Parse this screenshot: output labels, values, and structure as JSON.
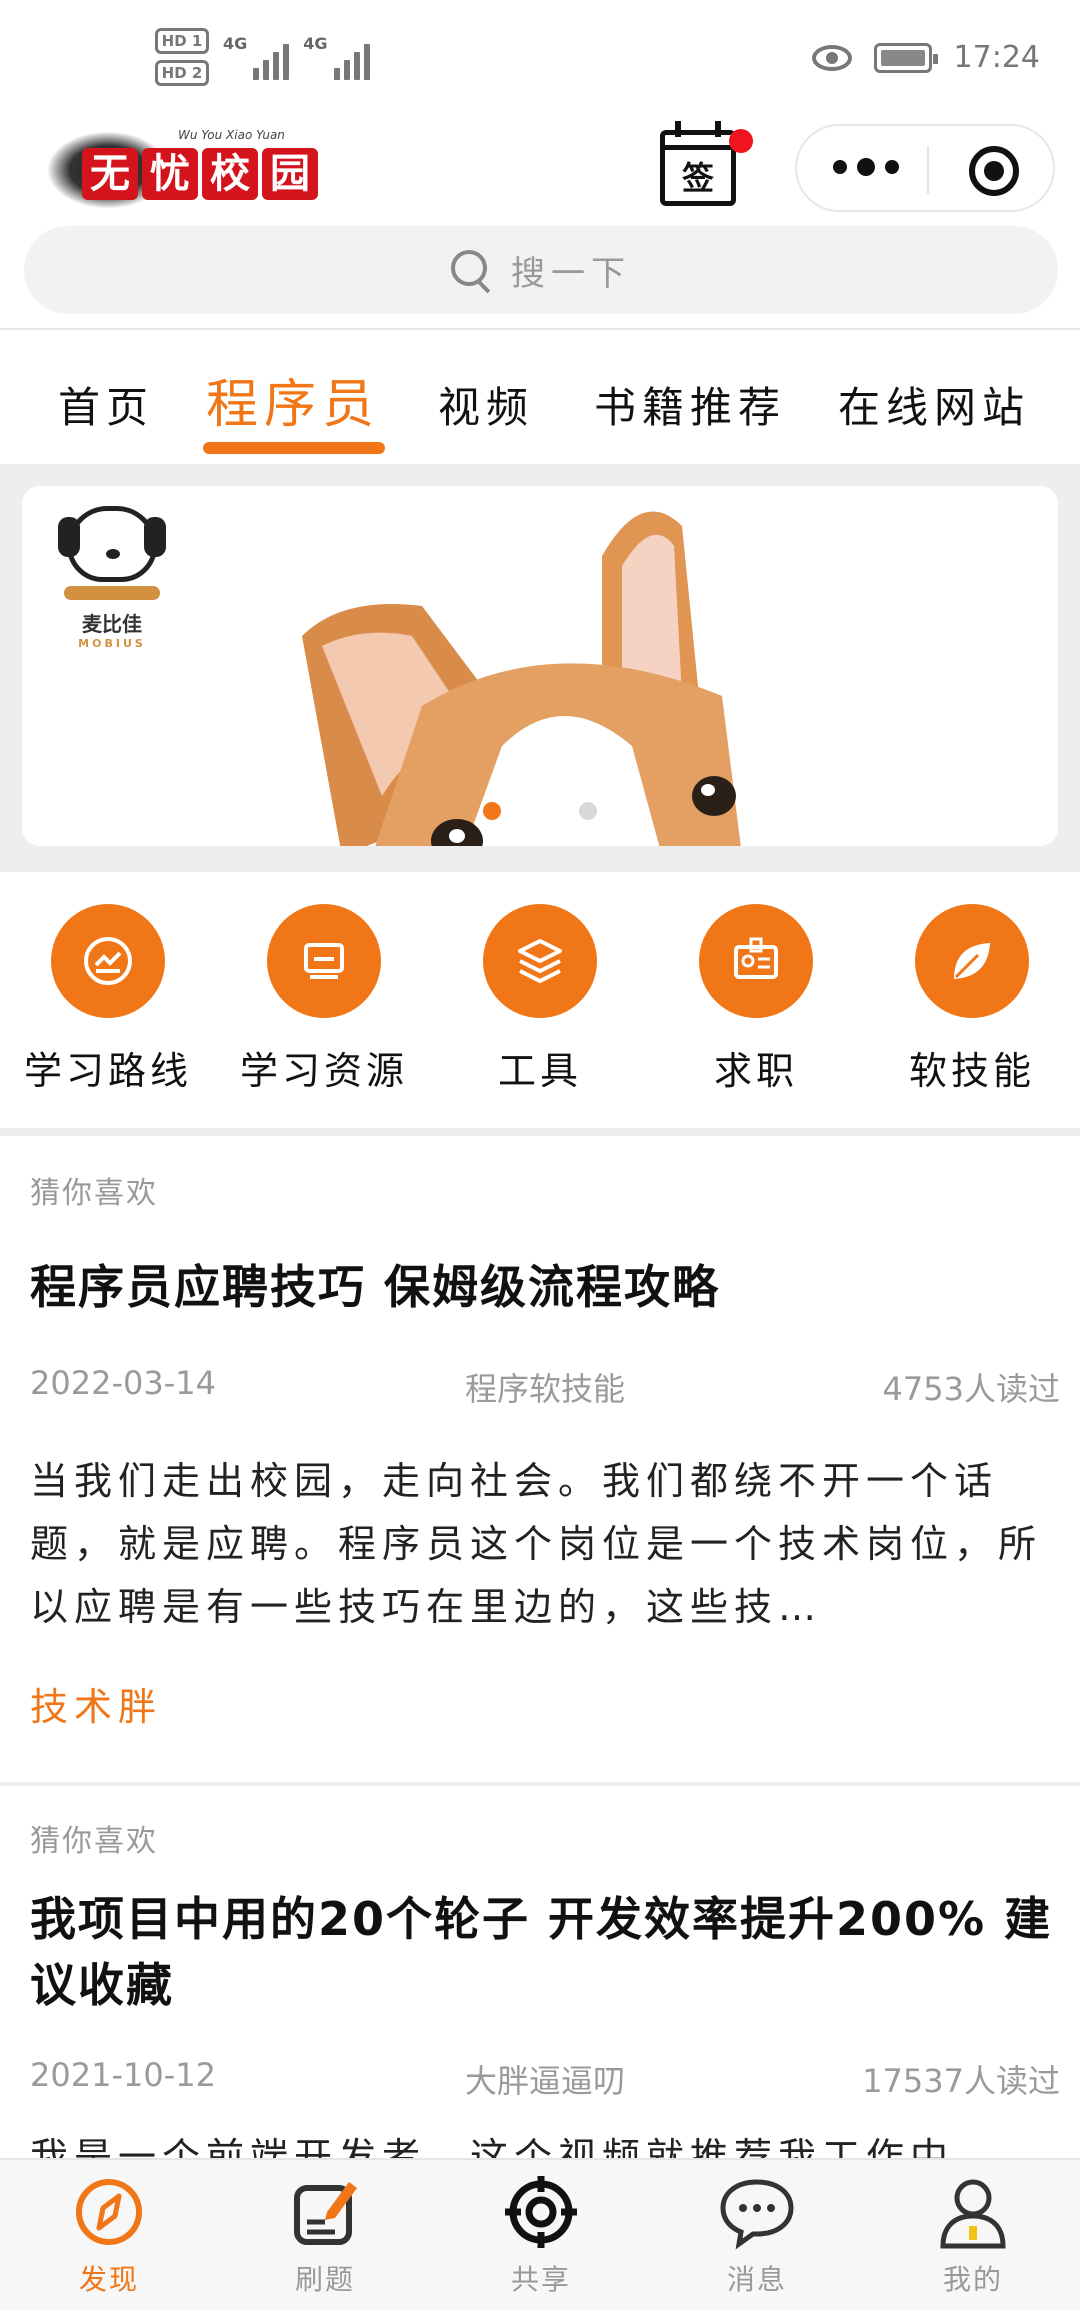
{
  "status_bar": {
    "hd1": "HD 1",
    "hd2": "HD 2",
    "net1": "4G",
    "net2": "4G",
    "time": "17:24",
    "icons": [
      "eye-icon",
      "battery-charging-icon"
    ]
  },
  "header": {
    "logo_text": "无忧校园",
    "logo_subtitle": "Wu You Xiao Yuan",
    "signin_label": "签",
    "capsule_icons": [
      "more-icon",
      "close-target-icon"
    ]
  },
  "search": {
    "placeholder": "搜一下"
  },
  "tabs": [
    {
      "label": "首页",
      "active": false
    },
    {
      "label": "程序员",
      "active": true
    },
    {
      "label": "视频",
      "active": false
    },
    {
      "label": "书籍推荐",
      "active": false
    },
    {
      "label": "在线网站",
      "active": false
    }
  ],
  "banner": {
    "brand_name": "麦比佳",
    "brand_sub": "MOBIUS",
    "slide_count": 2,
    "active_slide": 1
  },
  "categories": [
    {
      "label": "学习路线",
      "icon": "chart-line-icon"
    },
    {
      "label": "学习资源",
      "icon": "monitor-icon"
    },
    {
      "label": "工具",
      "icon": "layers-icon"
    },
    {
      "label": "求职",
      "icon": "id-badge-icon"
    },
    {
      "label": "软技能",
      "icon": "leaf-icon"
    }
  ],
  "articles": [
    {
      "tag": "猜你喜欢",
      "title": "程序员应聘技巧 保姆级流程攻略",
      "date": "2022-03-14",
      "category": "程序软技能",
      "reads": "4753人读过",
      "summary": "当我们走出校园，走向社会。我们都绕不开一个话题，就是应聘。程序员这个岗位是一个技术岗位，所以应聘是有一些技巧在里边的，这些技…",
      "author": "技术胖"
    },
    {
      "tag": "猜你喜欢",
      "title": "我项目中用的20个轮子 开发效率提升200% 建议收藏",
      "date": "2021-10-12",
      "category": "大胖逼逼叨",
      "reads": "17537人读过",
      "summary": "我是一个前端开发者，这个视频就推荐我工作中"
    }
  ],
  "bottom_nav": [
    {
      "label": "发现",
      "icon": "compass-icon",
      "active": true
    },
    {
      "label": "刷题",
      "icon": "edit-note-icon",
      "active": false
    },
    {
      "label": "共享",
      "icon": "target-share-icon",
      "active": false
    },
    {
      "label": "消息",
      "icon": "chat-bubble-icon",
      "active": false
    },
    {
      "label": "我的",
      "icon": "user-icon",
      "active": false
    }
  ],
  "colors": {
    "accent": "#f07618",
    "logo_red": "#d4141c",
    "badge_red": "#f0141e",
    "muted_text": "#999999"
  }
}
